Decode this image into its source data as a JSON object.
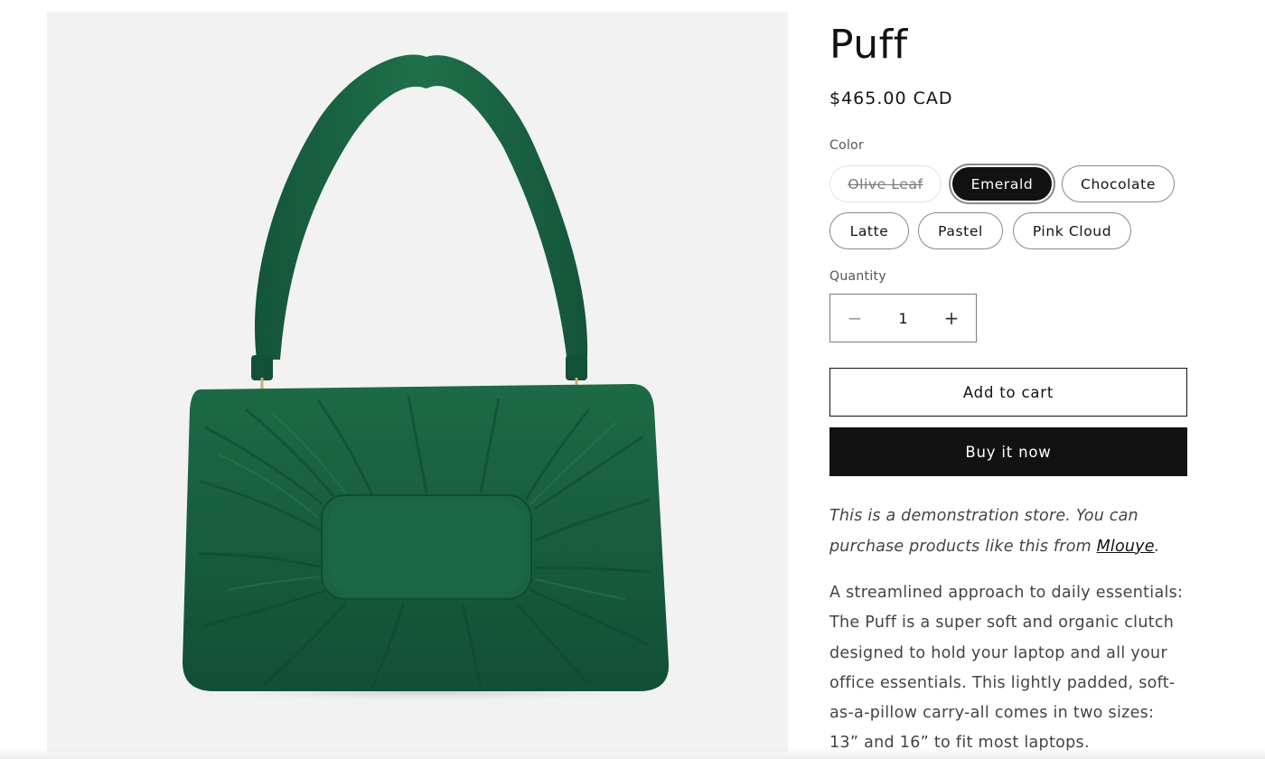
{
  "product": {
    "title": "Puff",
    "price": "$465.00 CAD",
    "image_icon": "green-leather-bag-image"
  },
  "color": {
    "label": "Color",
    "options": [
      {
        "label": "Olive Leaf",
        "state": "unavailable"
      },
      {
        "label": "Emerald",
        "state": "selected"
      },
      {
        "label": "Chocolate",
        "state": "available"
      },
      {
        "label": "Latte",
        "state": "available"
      },
      {
        "label": "Pastel",
        "state": "available"
      },
      {
        "label": "Pink Cloud",
        "state": "available"
      }
    ]
  },
  "quantity": {
    "label": "Quantity",
    "value": "1",
    "decrease_glyph": "−",
    "increase_glyph": "+"
  },
  "actions": {
    "add_to_cart": "Add to cart",
    "buy_now": "Buy it now"
  },
  "notice": {
    "text_before": "This is a demonstration store. You can purchase products like this from ",
    "link": "Mlouye",
    "text_after": "."
  },
  "description": "A streamlined approach to daily essentials: The Puff is a super soft and organic clutch designed to hold your laptop and all your office essentials. This lightly padded, soft-as-a-pillow carry-all comes in two sizes: 13” and 16” to fit most laptops.",
  "colors": {
    "bag": "#1f6a47",
    "bag_dark": "#13503a",
    "background": "#f2f2f2",
    "accent": "#121212"
  }
}
